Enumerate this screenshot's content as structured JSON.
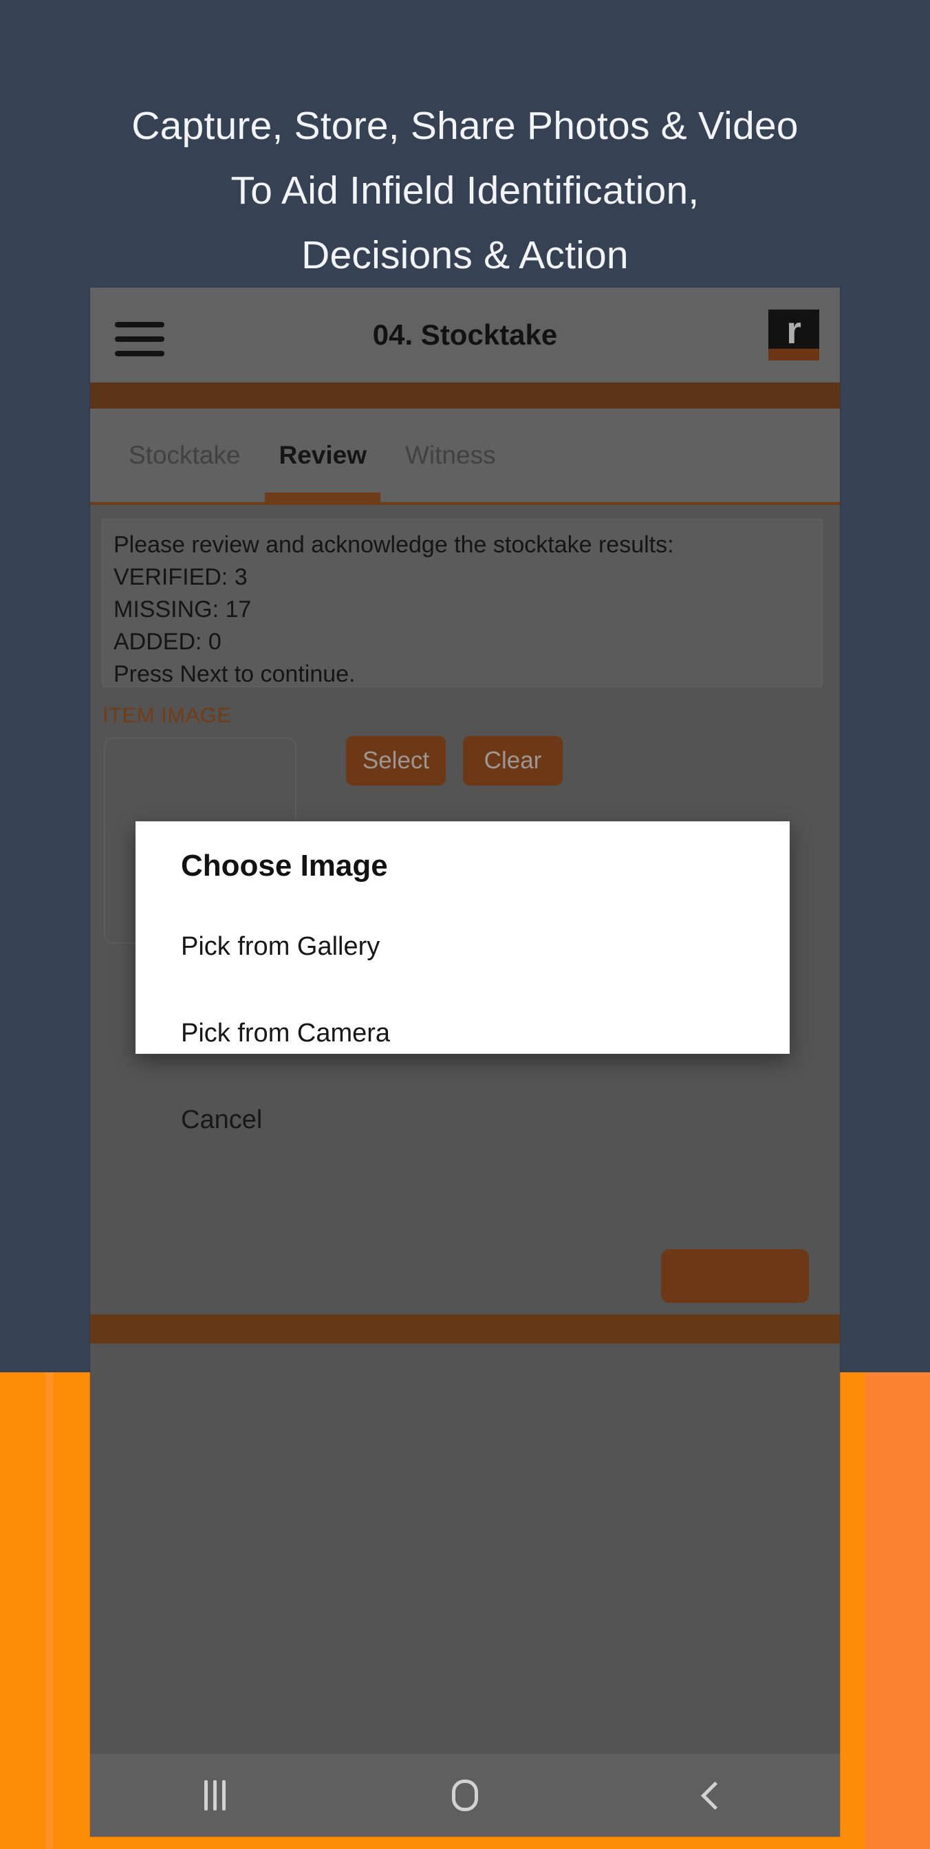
{
  "promo": {
    "headline": "Capture, Store, Share Photos & Video\nTo Aid Infield Identification,\nDecisions & Action",
    "background_color": "#364154",
    "accent_orange": "#FD8C09"
  },
  "app": {
    "appbar": {
      "menu_icon": "hamburger-menu-icon",
      "title": "04. Stocktake",
      "logo_letter": "r",
      "logo_background": "#0a0a0a",
      "logo_stripe_color": "#8a3d0d"
    },
    "tabs": [
      {
        "label": "Stocktake",
        "active": false
      },
      {
        "label": "Review",
        "active": true
      },
      {
        "label": "Witness",
        "active": false
      }
    ],
    "review": {
      "text": "Please review and acknowledge the stocktake results:\nVERIFIED: 3\nMISSING: 17\nADDED: 0\nPress Next to continue.",
      "verified": 3,
      "missing": 17,
      "added": 0
    },
    "item_image": {
      "label": "ITEM IMAGE",
      "select_label": "Select",
      "clear_label": "Clear"
    },
    "next_label": "",
    "accent_brown": "#8a3f0e"
  },
  "dialog": {
    "title": "Choose Image",
    "options": [
      {
        "label": "Pick from Gallery"
      },
      {
        "label": "Pick from Camera"
      },
      {
        "label": "Cancel"
      }
    ]
  },
  "android_nav": {
    "recents_label": "recents-icon",
    "home_label": "home-icon",
    "back_label": "back-icon"
  }
}
